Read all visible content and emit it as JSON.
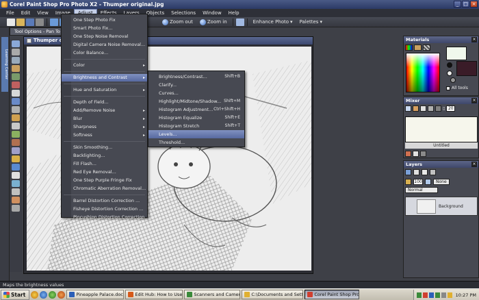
{
  "window": {
    "title": "Corel Paint Shop Pro Photo X2 - Thumper original.jpg",
    "min": "_",
    "max": "□",
    "close": "×"
  },
  "menubar": [
    "File",
    "Edit",
    "View",
    "Image",
    "Adjust",
    "Effects",
    "Layers",
    "Objects",
    "Selections",
    "Window",
    "Help"
  ],
  "toolbar": {
    "zoom_out": "Zoom out",
    "zoom_in": "Zoom in",
    "enhance_photo": "Enhance Photo",
    "palettes": "Palettes"
  },
  "tool_options": "Tool Options - Pan To",
  "learning_center": "Learning Center",
  "document": {
    "title": "Thumper orig"
  },
  "adjust_menu": [
    {
      "label": "One Step Photo Fix",
      "sub": false
    },
    {
      "label": "Smart Photo Fix...",
      "sub": false
    },
    {
      "label": "One Step Noise Removal",
      "sub": false
    },
    {
      "label": "Digital Camera Noise Removal...",
      "sub": false
    },
    {
      "label": "Color Balance...",
      "sub": false
    },
    {
      "sep": true
    },
    {
      "label": "Color",
      "sub": true
    },
    {
      "sep": true
    },
    {
      "label": "Brightness and Contrast",
      "sub": true,
      "highlight": true
    },
    {
      "sep": true
    },
    {
      "label": "Hue and Saturation",
      "sub": true
    },
    {
      "sep": true
    },
    {
      "label": "Depth of Field...",
      "sub": false
    },
    {
      "label": "Add/Remove Noise",
      "sub": true
    },
    {
      "label": "Blur",
      "sub": true
    },
    {
      "label": "Sharpness",
      "sub": true
    },
    {
      "label": "Softness",
      "sub": true
    },
    {
      "sep": true
    },
    {
      "label": "Skin Smoothing...",
      "sub": false
    },
    {
      "label": "Backlighting...",
      "sub": false
    },
    {
      "label": "Fill Flash...",
      "sub": false
    },
    {
      "label": "Red Eye Removal...",
      "sub": false
    },
    {
      "label": "One Step Purple Fringe Fix",
      "sub": false
    },
    {
      "label": "Chromatic Aberration Removal...",
      "sub": false
    },
    {
      "sep": true
    },
    {
      "label": "Barrel Distortion Correction ...",
      "sub": false
    },
    {
      "label": "Fisheye Distortion Correction ...",
      "sub": false
    },
    {
      "label": "Pincushion Distortion Correction ...",
      "sub": false
    }
  ],
  "brightness_submenu": [
    {
      "label": "Brightness/Contrast...",
      "shortcut": "Shift+B"
    },
    {
      "label": "Clarify...",
      "shortcut": ""
    },
    {
      "label": "Curves...",
      "shortcut": ""
    },
    {
      "label": "Highlight/Midtone/Shadow...",
      "shortcut": "Shift+M"
    },
    {
      "label": "Histogram Adjustment...",
      "shortcut": "Ctrl+Shift+H"
    },
    {
      "label": "Histogram Equalize",
      "shortcut": "Shift+E"
    },
    {
      "label": "Histogram Stretch",
      "shortcut": "Shift+T"
    },
    {
      "label": "Levels...",
      "shortcut": "",
      "highlight": true
    },
    {
      "label": "Threshold...",
      "shortcut": ""
    }
  ],
  "materials": {
    "title": "Materials",
    "all_tools": "All tools",
    "fg_color": "#f0f8ec",
    "bg_color": "#3a1c28"
  },
  "mixer": {
    "title": "Mixer",
    "size": "20",
    "untitled": "Untitled"
  },
  "layers": {
    "title": "Layers",
    "opacity": "100",
    "blend": "Normal",
    "mask": "None",
    "layer_name": "Background"
  },
  "status": "Maps the brightness values",
  "taskbar": {
    "start": "Start",
    "tasks": [
      {
        "label": "Pineapple Palace.doc - M...",
        "color": "#2b5fb8"
      },
      {
        "label": "Edit Hub: How to Use Pai...",
        "color": "#d65a1a"
      },
      {
        "label": "Scanners and Cameras",
        "color": "#3a8a3a"
      },
      {
        "label": "C:\\Documents and Settin...",
        "color": "#e0b030"
      },
      {
        "label": "Corel Paint Shop Pro ...",
        "color": "#d04030",
        "active": true
      }
    ],
    "clock": "10:27 PM"
  }
}
